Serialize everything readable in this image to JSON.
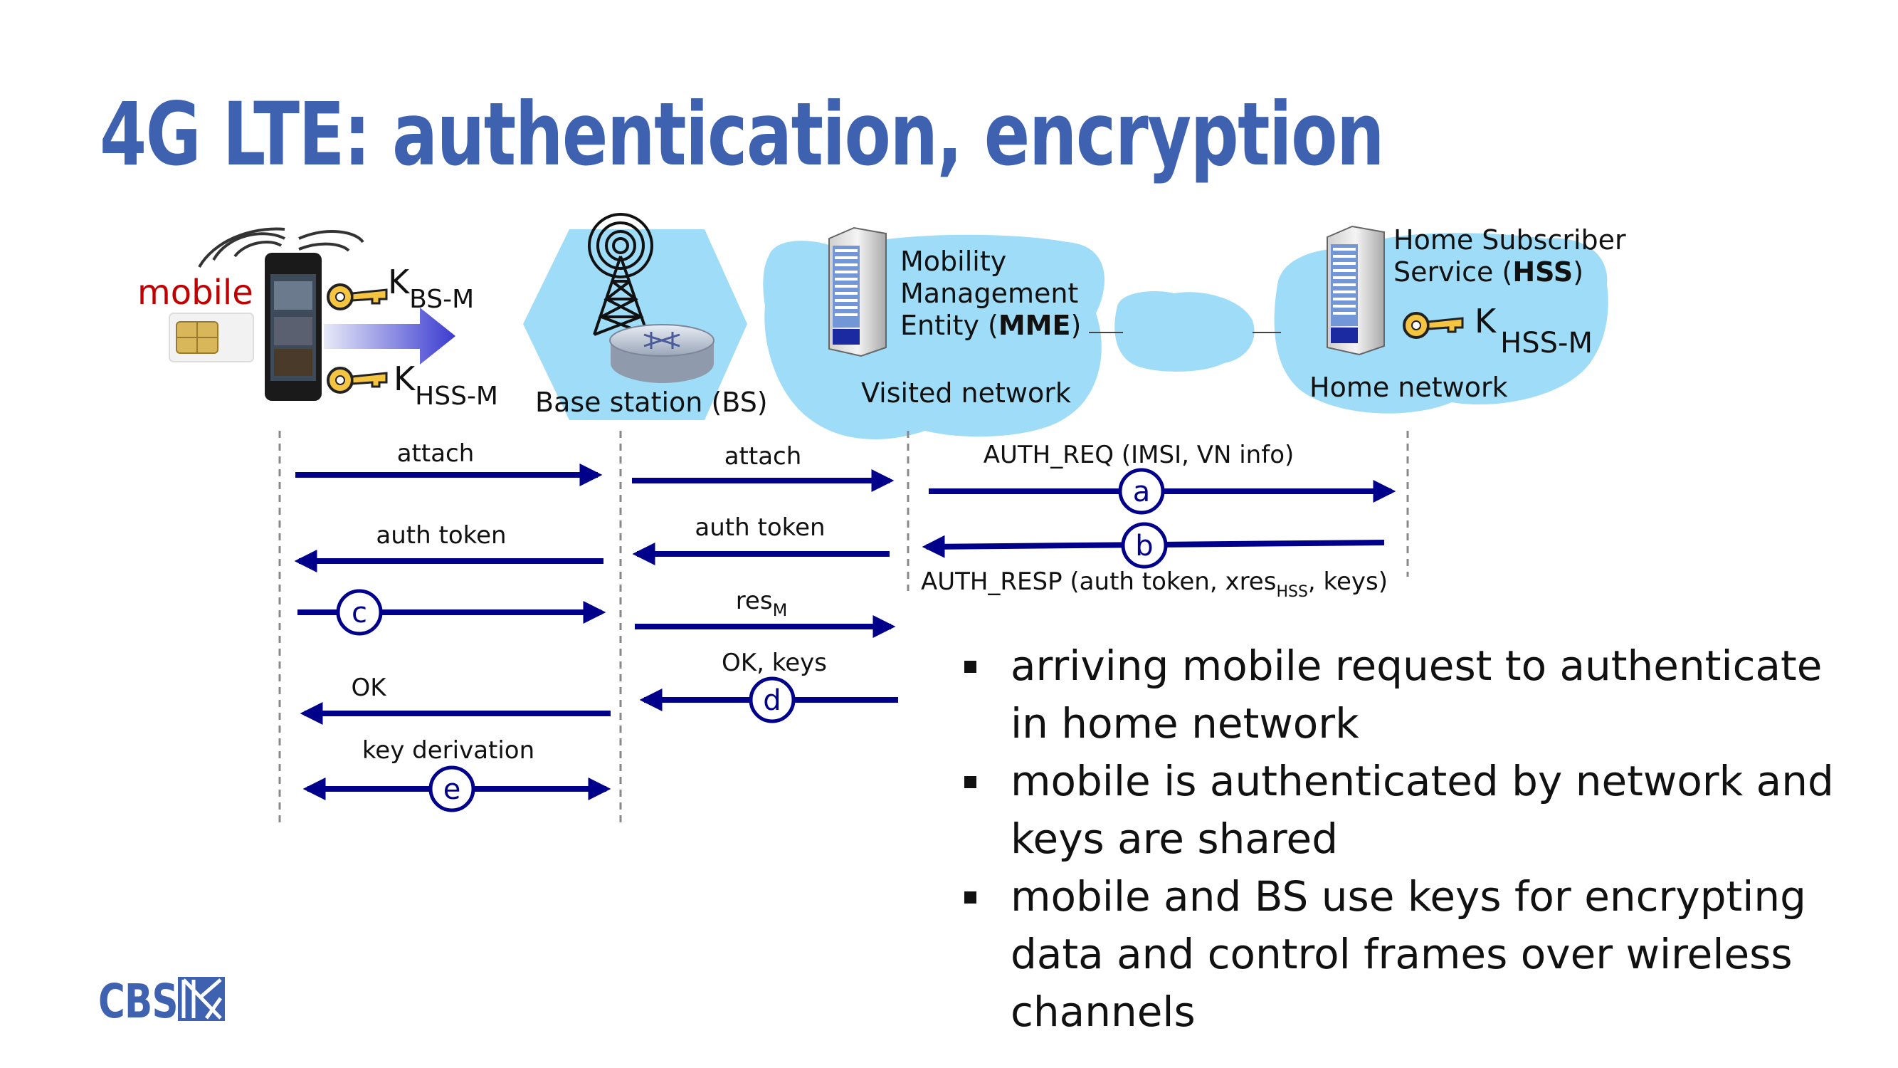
{
  "title": "4G LTE: authentication, encryption",
  "colors": {
    "title": "#3f62b0",
    "arrow": "#00008b",
    "cloud": "#9fdcf8",
    "mobile_label": "#c00000"
  },
  "nodes": {
    "mobile": "mobile",
    "key_bs_m_letter": "K",
    "key_bs_m_sub": "BS-M",
    "key_hss_m_letter": "K",
    "key_hss_m_sub": "HSS-M",
    "base_station": "Base station (BS)",
    "mme_line1": "Mobility",
    "mme_line2": "Management",
    "mme_line3_pre": "Entity (",
    "mme_line3_bold": "MME",
    "mme_line3_post": ")",
    "visited_network": "Visited network",
    "hss_line1": "Home Subscriber",
    "hss_line2_pre": "Service (",
    "hss_line2_bold": "HSS",
    "hss_line2_post": ")",
    "hss_key_letter": "K",
    "hss_key_sub": "HSS-M",
    "home_network": "Home network"
  },
  "messages": {
    "m_attach_1": "attach",
    "m_auth_token_1": "auth token",
    "m_attach_2": "attach",
    "m_auth_token_2": "auth token",
    "m_res": "res",
    "m_res_sub": "M",
    "m_ok_keys": "OK, keys",
    "m_ok": "OK",
    "m_key_derivation": "key derivation",
    "m_auth_req": "AUTH_REQ (IMSI, VN info)",
    "m_auth_resp_pre": "AUTH_RESP (auth token, xres",
    "m_auth_resp_sub": "HSS",
    "m_auth_resp_post": ", keys)"
  },
  "step_labels": {
    "a": "a",
    "b": "b",
    "c": "c",
    "d": "d",
    "e": "e"
  },
  "bullets": [
    "arriving mobile request to authenticate in home network",
    "mobile is authenticated by network and keys are shared",
    "mobile and BS use keys for encrypting data and control frames over wireless channels"
  ],
  "logo": "CBS",
  "icons": [
    "mobile-phone-icon",
    "sim-card-icon",
    "key-icon",
    "cell-tower-icon",
    "router-icon",
    "server-icon",
    "logo-mark-icon"
  ]
}
